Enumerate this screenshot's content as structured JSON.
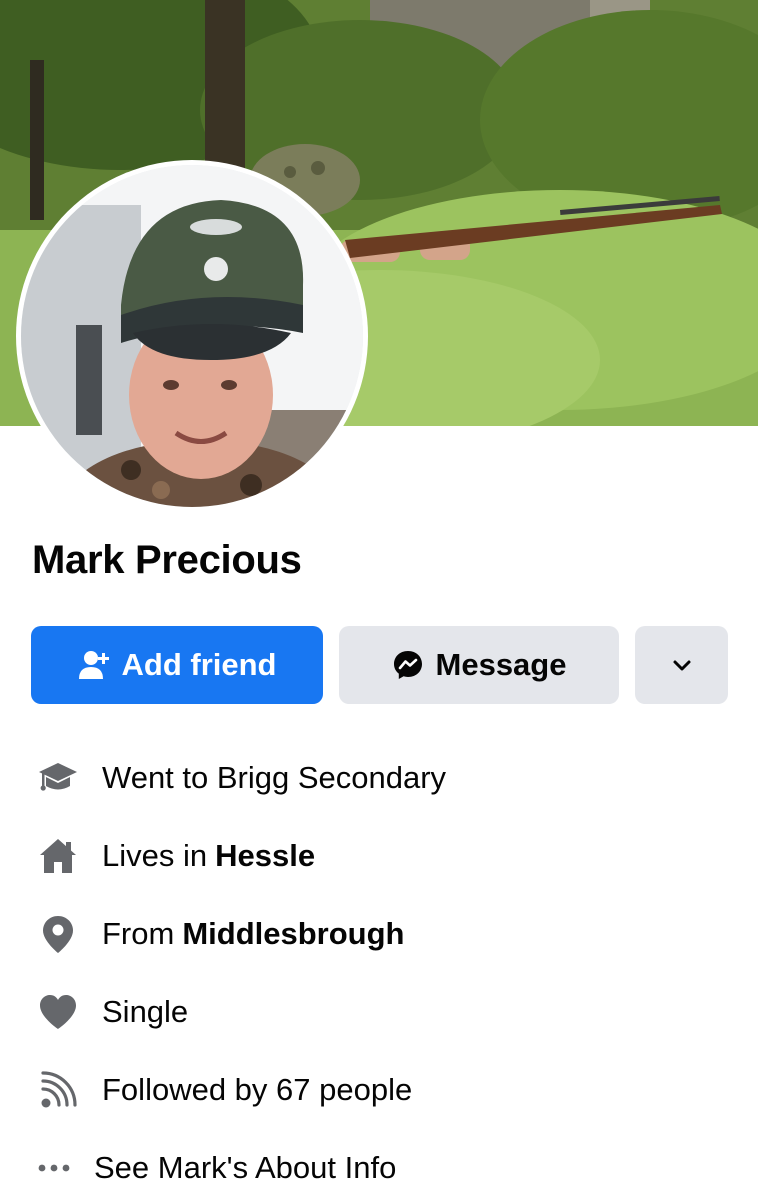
{
  "profile": {
    "name": "Mark Precious"
  },
  "actions": {
    "add_friend_label": "Add friend",
    "message_label": "Message"
  },
  "info": {
    "education_text": "Went to Brigg Secondary",
    "lives_prefix": "Lives in",
    "lives_place": "Hessle",
    "from_prefix": "From",
    "from_place": "Middlesbrough",
    "relationship_text": "Single",
    "followers_text": "Followed by 67 people",
    "about_link_text": "See Mark's About Info"
  },
  "icons": {
    "add_friend": "person-add-icon",
    "message": "messenger-icon",
    "more": "chevron-down-icon",
    "education": "graduation-cap-icon",
    "lives": "home-icon",
    "from": "location-pin-icon",
    "relationship": "heart-icon",
    "followers": "rss-feed-icon",
    "about": "more-dots-icon"
  },
  "colors": {
    "primary": "#1877f2",
    "secondary_button": "#e4e6eb",
    "icon_gray": "#65676b",
    "text": "#050505"
  }
}
